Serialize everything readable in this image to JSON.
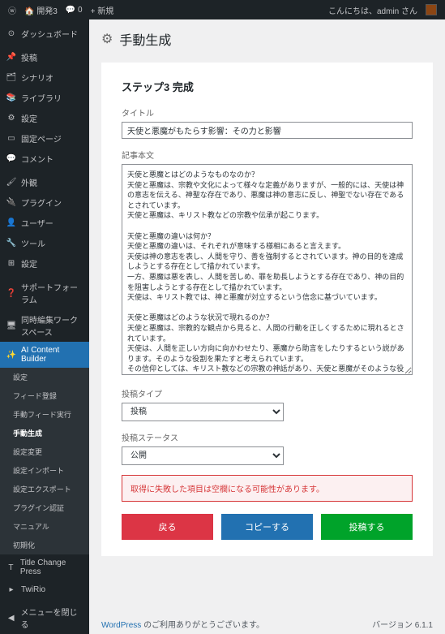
{
  "adminBar": {
    "site": "開発3",
    "comments": "0",
    "new": "新規",
    "greeting": "こんにちは、",
    "user": "admin さん"
  },
  "sidebar": {
    "dashboard": "ダッシュボード",
    "posts": "投稿",
    "scenario": "シナリオ",
    "library": "ライブラリ",
    "settings": "設定",
    "fixedPages": "固定ページ",
    "comments": "コメント",
    "appearance": "外観",
    "plugins": "プラグイン",
    "users": "ユーザー",
    "tools": "ツール",
    "settings2": "設定",
    "supportForum": "サポートフォーラム",
    "workspace": "同時編集ワークスペース",
    "aiBuilder": "AI Content Builder",
    "sub": {
      "setting": "設定",
      "feedReg": "フィード登録",
      "feedExec": "手動フィード実行",
      "manualGen": "手動生成",
      "settingChange": "設定変更",
      "settingImport": "設定インポート",
      "settingExport": "設定エクスポート",
      "pluginAuth": "プラグイン認証",
      "manual": "マニュアル",
      "init": "初期化"
    },
    "titleChange": "Title Change Press",
    "twiRio": "TwiRio",
    "collapse": "メニューを閉じる"
  },
  "page": {
    "heading": "手動生成",
    "stepTitle": "ステップ3 完成",
    "titleLabel": "タイトル",
    "titleValue": "天使と悪魔がもたらす影響：その力と影響",
    "bodyLabel": "記事本文",
    "bodyValue": "天使と悪魔とはどのようなものなのか？\n天使と悪魔は、宗教や文化によって様々な定義がありますが、一般的には、天使は神の意志を伝える、神聖な存在であり、悪魔は神の意志に反し、神聖でない存在であるとされています。\n天使と悪魔は、キリスト教などの宗教や伝承が起こります。\n\n天使と悪魔の違いは何か？\n天使と悪魔の違いは、それぞれが意味する様相にあると言えます。\n天使は神の意志を表し、人間を守り、善を強制するとされています。神の目的を達成しようとする存在として描かれています。\n一方、悪魔は悪を表し、人間を苦しめ、罪を助長しようとする存在であり、神の目的を阻害しようとする存在として描かれています。\n天使は、キリスト教では、神と悪魔が対立するという信念に基づいています。\n\n天使と悪魔はどのような状況で現れるのか？\n天使と悪魔は、宗教的な観点から見ると、人間の行動を正しくするために現れるとされています。\n天使は、人間を正しい方向に向かわせたり、悪魔から助言をしたりするという説があります。そのような役割を果たすと考えられています。\nその信仰としては、キリスト教などの宗教の神話があり、天使と悪魔がそのような役割を果たしているとされています。\n\n人間と天使と悪魔の関係はどういうものか？\n人間と天使と悪魔の関係については、キリスト教などの宗教によると、天使と悪魔は神の創造物であり、人間は神の像であるとも記されています。\nまた、キリスト教では、悪魔が人間に害をもたらす力を持っていると考えられています。\nしかし、天使と悪魔は人間とどのように影響を及ぼすのは、悪魔にあるとも言えます。\nこれは、キリスト教では、天使が人間に対して善の存在だけを持っているわけではなく、悪魔と同様に悪を誘うともいわれています。\n\n天使と悪魔がもたらす影響とはどんなものか？\n天使と悪魔がもたらす影響には、人間がどのような行動をとるかに大きい影響を与えます。\n天使は人間を良い方向に向かせる力を持ち、悪魔は人間に不正な力を与えます。\n天使は人間を善に導き、悪魔は人間を悪に導きます。\n天使は人間を良の道へと誘いますが、悪魔は悪の道を歩ませます。\nまた、悪魔は、原罪的な実気や疑似などの奥深い、観念を触発させるといわれています。\n\n[要約]\n天使と悪魔は、宗教や文化によって様々な定義があり、一般的には、天使は神の意志を伝える神聖な存在であり、悪魔は神の意志に反し、神聖でない存在であるとされています。それぞれの違いは、天使は神の意志を表して神聖であり、悪魔は悪を表すと思えます。人間と天使と悪魔の関係については、キリスト教などの聖書によると、天使と悪魔は神の創造物であり、人間は神の像であると記されています。",
    "postTypeLabel": "投稿タイプ",
    "postTypeValue": "投稿",
    "postStatusLabel": "投稿ステータス",
    "postStatusValue": "公開",
    "alertText": "取得に失敗した項目は空欄になる可能性があります。",
    "btnBack": "戻る",
    "btnCopy": "コピーする",
    "btnPost": "投稿する"
  },
  "footer": {
    "thanks": "WordPress のご利用ありがとうございます。",
    "wp": "WordPress",
    "version": "バージョン 6.1.1"
  }
}
